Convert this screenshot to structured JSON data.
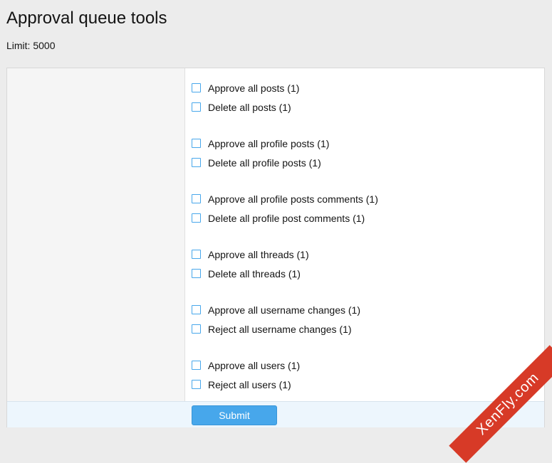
{
  "header": {
    "title": "Approval queue tools",
    "limit_text": "Limit: 5000"
  },
  "groups": [
    {
      "options": [
        {
          "label": "Approve all posts (1)",
          "checked": false
        },
        {
          "label": "Delete all posts (1)",
          "checked": false
        }
      ]
    },
    {
      "options": [
        {
          "label": "Approve all profile posts (1)",
          "checked": false
        },
        {
          "label": "Delete all profile posts (1)",
          "checked": false
        }
      ]
    },
    {
      "options": [
        {
          "label": "Approve all profile posts comments (1)",
          "checked": false
        },
        {
          "label": "Delete all profile post comments (1)",
          "checked": false
        }
      ]
    },
    {
      "options": [
        {
          "label": "Approve all threads (1)",
          "checked": false
        },
        {
          "label": "Delete all threads (1)",
          "checked": false
        }
      ]
    },
    {
      "options": [
        {
          "label": "Approve all username changes (1)",
          "checked": false
        },
        {
          "label": "Reject all username changes (1)",
          "checked": false
        }
      ]
    },
    {
      "options": [
        {
          "label": "Approve all users (1)",
          "checked": false
        },
        {
          "label": "Reject all users (1)",
          "checked": false
        }
      ]
    }
  ],
  "footer": {
    "submit_label": "Submit"
  },
  "watermark": {
    "text": "XenFly.com"
  },
  "colors": {
    "accent": "#47a7eb",
    "footer_bg": "#edf6fd",
    "watermark_bg": "#d73a27"
  }
}
